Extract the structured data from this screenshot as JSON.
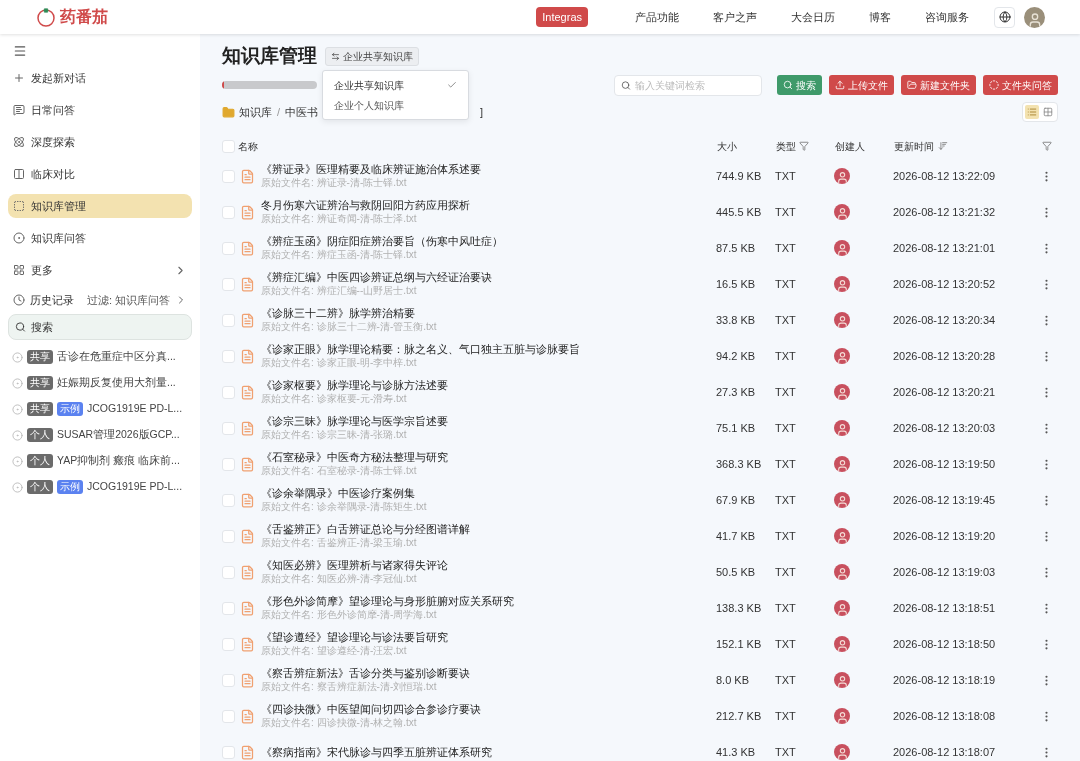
{
  "header": {
    "logo": "药番茄",
    "badge": "Integras",
    "nav": [
      "产品功能",
      "客户之声",
      "大会日历",
      "博客",
      "咨询服务"
    ]
  },
  "sidebar": {
    "items": [
      {
        "label": "发起新对话",
        "selected": false
      },
      {
        "label": "日常问答",
        "selected": false
      },
      {
        "label": "深度探索",
        "selected": false
      },
      {
        "label": "临床对比",
        "selected": false
      },
      {
        "label": "知识库管理",
        "selected": true
      },
      {
        "label": "知识库问答",
        "selected": false
      },
      {
        "label": "更多",
        "selected": false
      }
    ],
    "history": {
      "label": "历史记录",
      "filter": "过滤: 知识库问答"
    },
    "search": {
      "placeholder": "搜索"
    },
    "conversations": [
      {
        "tags": [
          {
            "label": "共享",
            "kind": "scope"
          }
        ],
        "title": "舌诊在危重症中区分真..."
      },
      {
        "tags": [
          {
            "label": "共享",
            "kind": "scope"
          }
        ],
        "title": "妊娠期反复使用大剂量..."
      },
      {
        "tags": [
          {
            "label": "共享",
            "kind": "scope"
          },
          {
            "label": "示例",
            "kind": "example"
          }
        ],
        "title": "JCOG1919E PD-L..."
      },
      {
        "tags": [
          {
            "label": "个人",
            "kind": "scope"
          }
        ],
        "title": "SUSAR管理2026版GCP..."
      },
      {
        "tags": [
          {
            "label": "个人",
            "kind": "scope"
          }
        ],
        "title": "YAP抑制剂 瘢痕 临床前..."
      },
      {
        "tags": [
          {
            "label": "个人",
            "kind": "scope"
          },
          {
            "label": "示例",
            "kind": "example"
          }
        ],
        "title": "JCOG1919E PD-L..."
      }
    ]
  },
  "main": {
    "title": "知识库管理",
    "library_button": "企业共享知识库",
    "progress": {
      "level": 0.02
    },
    "dropdown": [
      {
        "label": "企业共享知识库",
        "selected": true
      },
      {
        "label": "企业个人知识库",
        "selected": false
      }
    ],
    "search": {
      "placeholder": "输入关键词检索"
    },
    "buttons": [
      {
        "label": "搜索",
        "kind": "search"
      },
      {
        "label": "上传文件",
        "kind": "upload"
      },
      {
        "label": "新建文件夹",
        "kind": "folder"
      },
      {
        "label": "文件夹问答",
        "kind": "ask"
      }
    ],
    "breadcrumb": [
      "知识库",
      "中医书"
    ],
    "breadcrumb_separator": "/",
    "breadcrumb_tail": "]",
    "view_modes": [
      {
        "kind": "list",
        "selected": true
      },
      {
        "kind": "grid",
        "selected": false
      }
    ],
    "table": {
      "all_checked": false,
      "columns": [
        "名称",
        "大小",
        "类型",
        "创建人",
        "更新时间"
      ],
      "rows": [
        {
          "checked": false,
          "name": "《辨证录》医理精要及临床辨证施治体系述要",
          "file": "原始文件名: 辨证录-清-陈士铎.txt",
          "size": "744.9 KB",
          "type": "TXT",
          "time": "2026-08-12 13:22:09"
        },
        {
          "checked": false,
          "name": "冬月伤寒六证辨治与救阴回阳方药应用探析",
          "file": "原始文件名: 辨证奇闻-清-陈士泽.txt",
          "size": "445.5 KB",
          "type": "TXT",
          "time": "2026-08-12 13:21:32"
        },
        {
          "checked": false,
          "name": "《辨症玉函》阴症阳症辨治要旨（伤寒中风吐症）",
          "file": "原始文件名: 辨症玉函-清-陈士铎.txt",
          "size": "87.5 KB",
          "type": "TXT",
          "time": "2026-08-12 13:21:01"
        },
        {
          "checked": false,
          "name": "《辨症汇编》中医四诊辨证总纲与六经证治要诀",
          "file": "原始文件名: 辨症汇编--山野居士.txt",
          "size": "16.5 KB",
          "type": "TXT",
          "time": "2026-08-12 13:20:52"
        },
        {
          "checked": false,
          "name": "《诊脉三十二辨》脉学辨治精要",
          "file": "原始文件名: 诊脉三十二辨-清-管玉衡.txt",
          "size": "33.8 KB",
          "type": "TXT",
          "time": "2026-08-12 13:20:34"
        },
        {
          "checked": false,
          "name": "《诊家正眼》脉学理论精要：脉之名义、气口独主五脏与诊脉要旨",
          "file": "原始文件名: 诊家正眼-明-李中梓.txt",
          "size": "94.2 KB",
          "type": "TXT",
          "time": "2026-08-12 13:20:28"
        },
        {
          "checked": false,
          "name": "《诊家枢要》脉学理论与诊脉方法述要",
          "file": "原始文件名: 诊家枢要-元-滑寿.txt",
          "size": "27.3 KB",
          "type": "TXT",
          "time": "2026-08-12 13:20:21"
        },
        {
          "checked": false,
          "name": "《诊宗三昧》脉学理论与医学宗旨述要",
          "file": "原始文件名: 诊宗三昧-清-张璐.txt",
          "size": "75.1 KB",
          "type": "TXT",
          "time": "2026-08-12 13:20:03"
        },
        {
          "checked": false,
          "name": "《石室秘录》中医奇方秘法整理与研究",
          "file": "原始文件名: 石室秘录-清-陈士铎.txt",
          "size": "368.3 KB",
          "type": "TXT",
          "time": "2026-08-12 13:19:50"
        },
        {
          "checked": false,
          "name": "《诊余举隅录》中医诊疗案例集",
          "file": "原始文件名: 诊余举隅录-清-陈矩生.txt",
          "size": "67.9 KB",
          "type": "TXT",
          "time": "2026-08-12 13:19:45"
        },
        {
          "checked": false,
          "name": "《舌鉴辨正》白舌辨证总论与分经图谱详解",
          "file": "原始文件名: 舌鉴辨正-清-梁玉瑜.txt",
          "size": "41.7 KB",
          "type": "TXT",
          "time": "2026-08-12 13:19:20"
        },
        {
          "checked": false,
          "name": "《知医必辨》医理辨析与诸家得失评论",
          "file": "原始文件名: 知医必辨-清-李冠仙.txt",
          "size": "50.5 KB",
          "type": "TXT",
          "time": "2026-08-12 13:19:03"
        },
        {
          "checked": false,
          "name": "《形色外诊简摩》望诊理论与身形脏腑对应关系研究",
          "file": "原始文件名: 形色外诊简摩-清-周学海.txt",
          "size": "138.3 KB",
          "type": "TXT",
          "time": "2026-08-12 13:18:51"
        },
        {
          "checked": false,
          "name": "《望诊遵经》望诊理论与诊法要旨研究",
          "file": "原始文件名: 望诊遵经-清-汪宏.txt",
          "size": "152.1 KB",
          "type": "TXT",
          "time": "2026-08-12 13:18:50"
        },
        {
          "checked": false,
          "name": "《察舌辨症新法》舌诊分类与鉴别诊断要诀",
          "file": "原始文件名: 察舌辨症新法-清-刘恒瑞.txt",
          "size": "8.0 KB",
          "type": "TXT",
          "time": "2026-08-12 13:18:19"
        },
        {
          "checked": false,
          "name": "《四诊抉微》中医望闻问切四诊合参诊疗要诀",
          "file": "原始文件名: 四诊抉微-清-林之翰.txt",
          "size": "212.7 KB",
          "type": "TXT",
          "time": "2026-08-12 13:18:08"
        },
        {
          "checked": false,
          "name": "《察病指南》宋代脉诊与四季五脏辨证体系研究",
          "size": "41.3 KB",
          "type": "TXT",
          "time": "2026-08-12 13:18:07"
        }
      ]
    }
  }
}
